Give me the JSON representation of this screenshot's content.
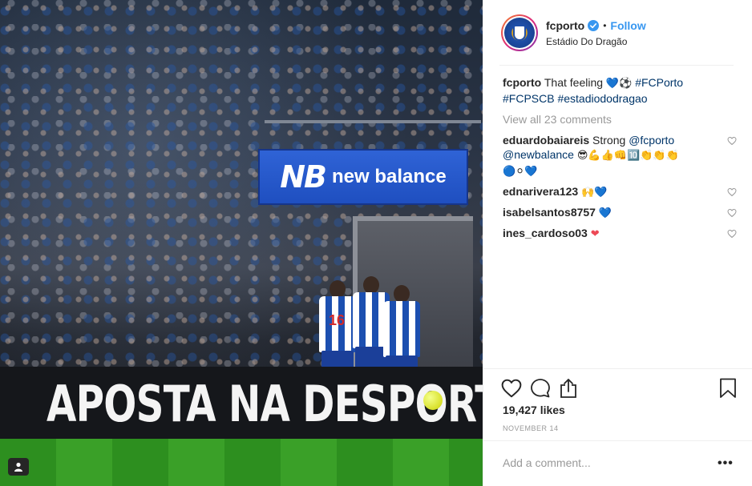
{
  "post": {
    "username": "fcporto",
    "follow_label": "Follow",
    "location": "Estádio Do Dragão",
    "caption": {
      "user": "fcporto",
      "text": "That feeling",
      "emojis": "💙⚽",
      "hashtags": [
        "#FCPorto",
        "#FCPSCB",
        "#estadiododragao"
      ]
    },
    "view_all_label": "View all 23 comments",
    "comments": [
      {
        "user": "eduardobaiareis",
        "text": "Strong",
        "mentions": [
          "@fcporto",
          "@newbalance"
        ],
        "emojis": "😎💪👍👊🔟👏👏👏",
        "emojis2": "🔵⚪💙"
      },
      {
        "user": "ednarivera123",
        "text": "",
        "emojis": "🙌💙"
      },
      {
        "user": "isabelsantos8757",
        "text": "",
        "emojis": "💙"
      },
      {
        "user": "ines_cardoso03",
        "text": "",
        "emojis": "❤"
      }
    ],
    "likes": "19,427 likes",
    "date": "NOVEMBER 14",
    "add_comment_placeholder": "Add a comment...",
    "more_label": "•••"
  },
  "photo": {
    "board_brand": "new balance",
    "board_logo": "NB",
    "ad_text": "APOSTA NA DESPORTI",
    "shirt_number": "16"
  },
  "icons": {
    "verified": "verified-badge-icon",
    "like": "heart-icon",
    "comment": "comment-bubble-icon",
    "share": "share-icon",
    "save": "bookmark-icon",
    "profile": "person-icon"
  },
  "colors": {
    "accent": "#3897f0",
    "tag": "#003569",
    "muted": "#999999",
    "text": "#262626"
  }
}
